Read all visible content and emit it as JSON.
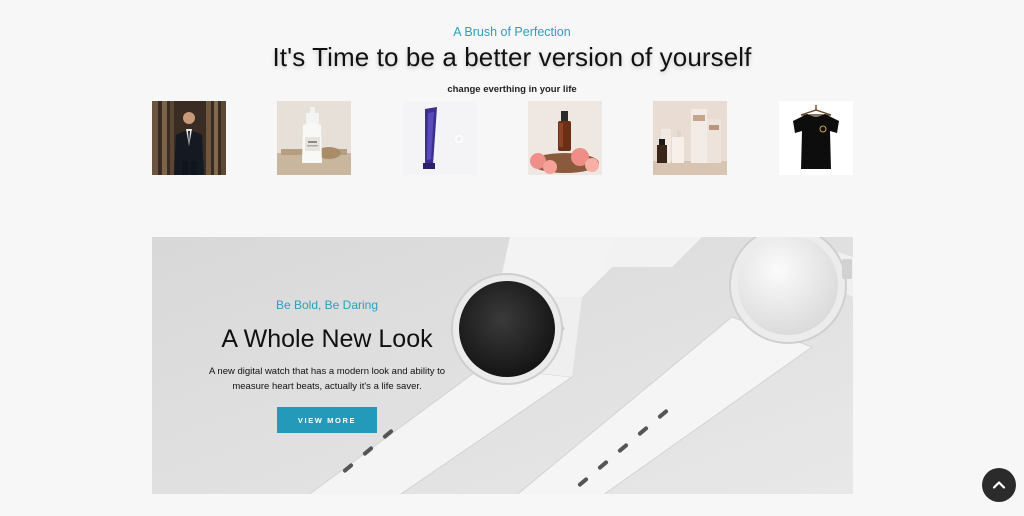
{
  "hero": {
    "subtitle": "A Brush of Perfection",
    "title": "It's Time to be a better version of yourself",
    "tagline": "change everthing in your life"
  },
  "products": [
    {
      "name": "suit-man-photo"
    },
    {
      "name": "lotion-bottle-photo"
    },
    {
      "name": "cream-tube-photo"
    },
    {
      "name": "serum-dropper-photo"
    },
    {
      "name": "skincare-set-photo"
    },
    {
      "name": "black-tshirt-photo"
    }
  ],
  "banner": {
    "subtitle": "Be Bold, Be Daring",
    "title": "A Whole New Look",
    "description_line1": "A new digital watch that has a modern look and ability to",
    "description_line2": "measure heart beats, actually it's a life saver.",
    "button_label": "VIEW MORE"
  },
  "colors": {
    "accent": "#2b9fc1",
    "button": "#239ab9",
    "background": "#f7f7f7",
    "scroll_button": "#2b2b2b"
  },
  "icons": {
    "scroll_top": "chevron-up-icon"
  }
}
